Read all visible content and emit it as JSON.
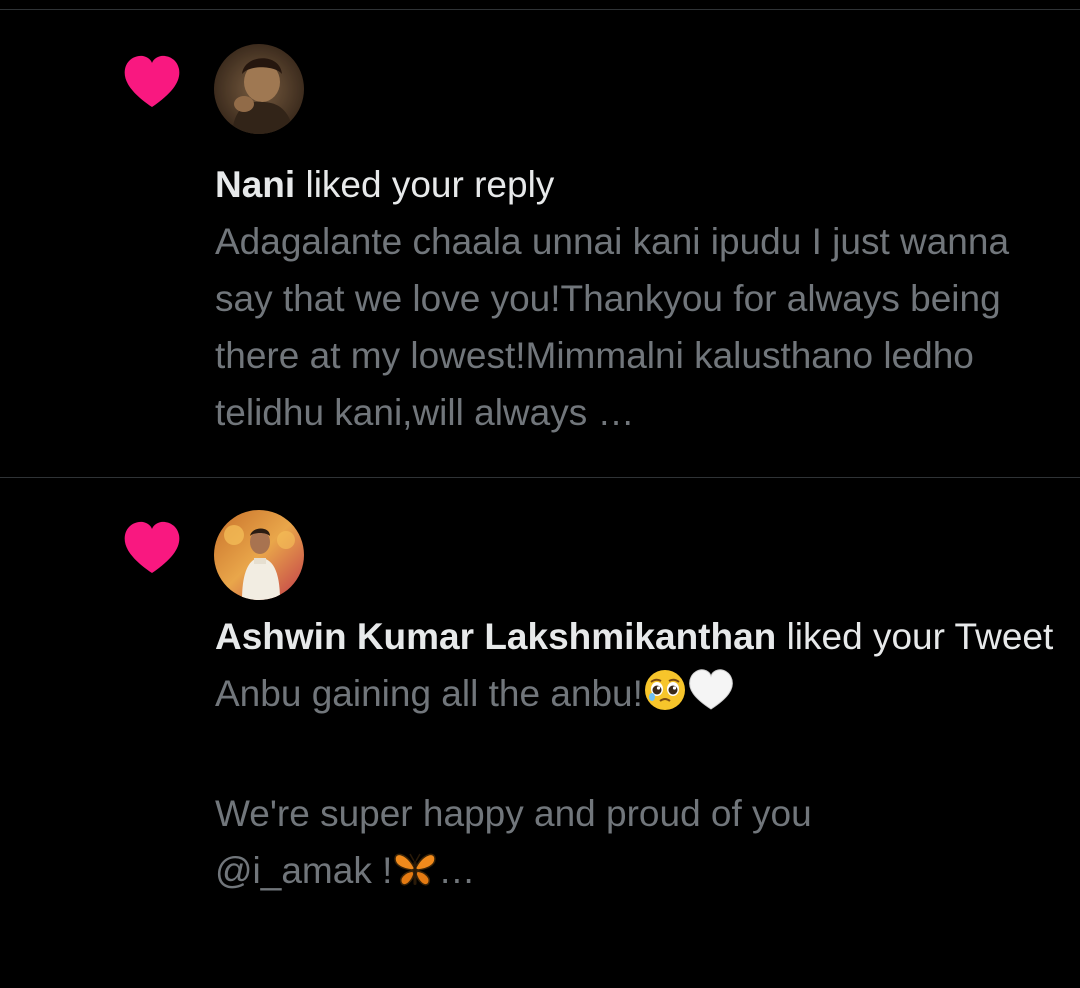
{
  "notifications": [
    {
      "user_name": "Nani",
      "action": " liked your reply",
      "text": "Adagalante chaala unnai kani ipudu I just wanna say that we love you!Thankyou for always being there at my lowest!Mimmalni kalusthano ledho telidhu kani,will always …",
      "icon": "heart-icon",
      "avatar": "avatar-nani"
    },
    {
      "user_name": "Ashwin Kumar Lakshmikanthan",
      "action": " liked your Tweet",
      "text_line1": "Anbu gaining all the anbu!",
      "text_line1_emojis": [
        "pleading-face-emoji",
        "white-heart-emoji"
      ],
      "text_line2": "We're super happy and proud of you",
      "text_line3": "@i_amak !",
      "text_line3_suffix": "…",
      "text_line3_emoji": "butterfly-emoji",
      "icon": "heart-icon",
      "avatar": "avatar-ashwin"
    }
  ],
  "colors": {
    "background": "#000000",
    "heart": "#f91880",
    "primary_text": "#e7e9ea",
    "secondary_text": "#71767b",
    "divider": "#2f3336"
  }
}
